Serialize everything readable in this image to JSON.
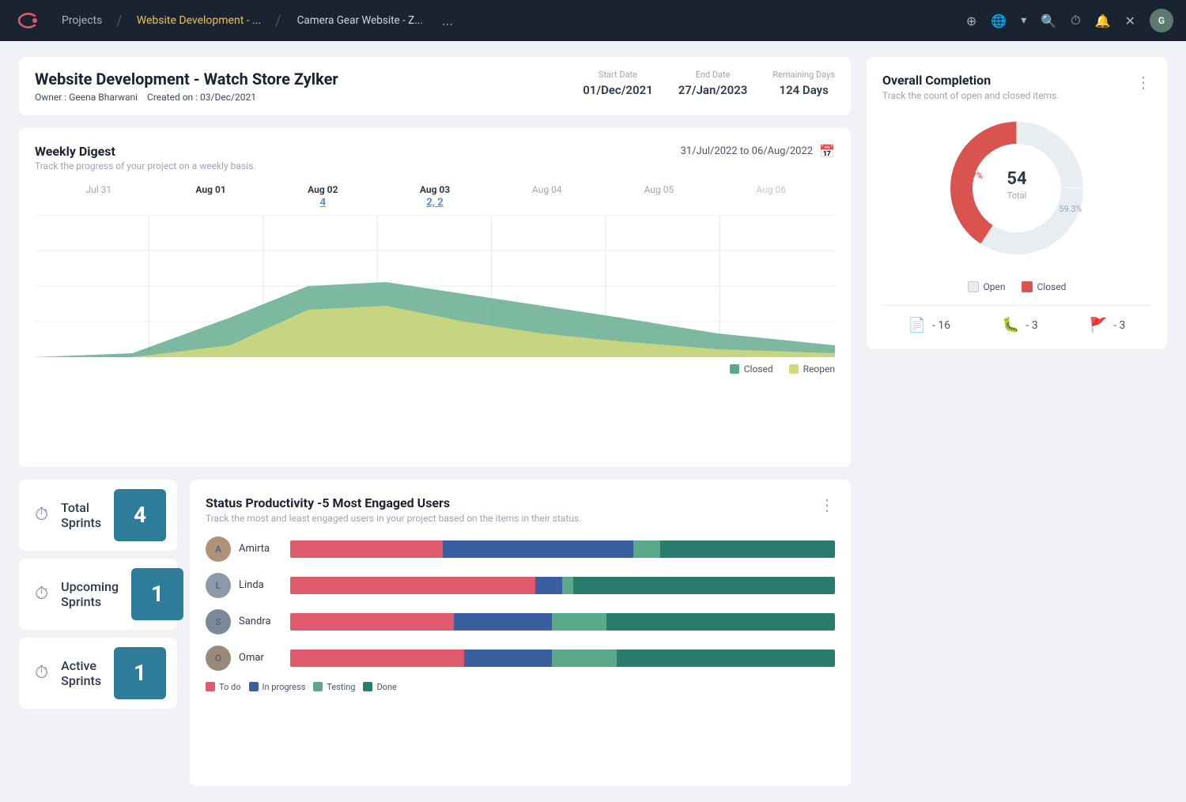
{
  "topnav": {
    "logo_symbol": "✂",
    "projects_label": "Projects",
    "tab1_label": "Website Development - ...",
    "tab2_label": "Camera Gear Website - Z...",
    "ellipsis": "...",
    "icons": [
      "⊕",
      "🌐",
      "👤",
      "🔍",
      "⏱",
      "🔔",
      "✕"
    ]
  },
  "project": {
    "title": "Website Development - Watch Store Zylker",
    "owner_label": "Owner :",
    "owner_name": "Geena Bharwani",
    "created_label": "Created on :",
    "created_date": "03/Dec/2021",
    "start_date_label": "Start Date",
    "start_date": "01/Dec/2021",
    "end_date_label": "End Date",
    "end_date": "27/Jan/2023",
    "remaining_label": "Remaining Days",
    "remaining": "124 Days"
  },
  "weekly_digest": {
    "title": "Weekly Digest",
    "subtitle": "Track the progress of your project on a weekly basis.",
    "date_range": "31/Jul/2022  to  06/Aug/2022",
    "dates": [
      "Jul 31",
      "Aug 01",
      "Aug 02",
      "Aug 03",
      "Aug 04",
      "Aug 05",
      "Aug 06"
    ],
    "bold_dates": [
      "Aug 01",
      "Aug 02",
      "Aug 03"
    ],
    "date_numbers": {
      "Aug 02": "4",
      "Aug 03": "2, 2"
    },
    "legend_closed": "Closed",
    "legend_reopen": "Reopen",
    "closed_color": "#5ca88a",
    "reopen_color": "#d4d97a"
  },
  "overall_completion": {
    "title": "Overall Completion",
    "subtitle": "Track the count of open and closed items.",
    "total": "54",
    "total_label": "Total",
    "open_pct": "59.3%",
    "closed_pct": "40.7%",
    "open_color": "#e8edf2",
    "closed_color": "#d9534f",
    "legend_open": "Open",
    "legend_closed": "Closed",
    "stat1_icon": "📋",
    "stat1_value": "- 16",
    "stat2_icon": "🐛",
    "stat2_value": "- 3",
    "stat3_icon": "🚩",
    "stat3_value": "- 3"
  },
  "sprints": [
    {
      "label": "Total Sprints",
      "count": "4",
      "icon": "⏱"
    },
    {
      "label": "Upcoming Sprints",
      "count": "1",
      "icon": "⏱"
    },
    {
      "label": "Active Sprints",
      "count": "1",
      "icon": "⏱"
    }
  ],
  "status_productivity": {
    "title": "Status Productivity -5 Most Engaged Users",
    "subtitle": "Track the most and least engaged users in your project based on the items in their status.",
    "users": [
      {
        "name": "Amirta",
        "avatar_initials": "A",
        "avatar_color": "#b0917a",
        "bars": [
          {
            "color": "#e05a6e",
            "pct": 28
          },
          {
            "color": "#3a5fa0",
            "pct": 35
          },
          {
            "color": "#5ca88a",
            "pct": 5
          },
          {
            "color": "#2a7d6e",
            "pct": 32
          }
        ]
      },
      {
        "name": "Linda",
        "avatar_initials": "L",
        "avatar_color": "#8a9aaa",
        "bars": [
          {
            "color": "#e05a6e",
            "pct": 45
          },
          {
            "color": "#3a5fa0",
            "pct": 5
          },
          {
            "color": "#5ca88a",
            "pct": 2
          },
          {
            "color": "#2a7d6e",
            "pct": 48
          }
        ]
      },
      {
        "name": "Sandra",
        "avatar_initials": "S",
        "avatar_color": "#7a8a9a",
        "bars": [
          {
            "color": "#e05a6e",
            "pct": 30
          },
          {
            "color": "#3a5fa0",
            "pct": 18
          },
          {
            "color": "#5ca88a",
            "pct": 10
          },
          {
            "color": "#2a7d6e",
            "pct": 42
          }
        ]
      },
      {
        "name": "Omar",
        "avatar_initials": "O",
        "avatar_color": "#9a8a7a",
        "bars": [
          {
            "color": "#e05a6e",
            "pct": 32
          },
          {
            "color": "#3a5fa0",
            "pct": 16
          },
          {
            "color": "#5ca88a",
            "pct": 12
          },
          {
            "color": "#2a7d6e",
            "pct": 40
          }
        ]
      }
    ],
    "legend": [
      {
        "label": "To do",
        "color": "#e05a6e"
      },
      {
        "label": "In progress",
        "color": "#3a5fa0"
      },
      {
        "label": "Testing",
        "color": "#5ca88a"
      },
      {
        "label": "Done",
        "color": "#2a7d6e"
      }
    ]
  }
}
